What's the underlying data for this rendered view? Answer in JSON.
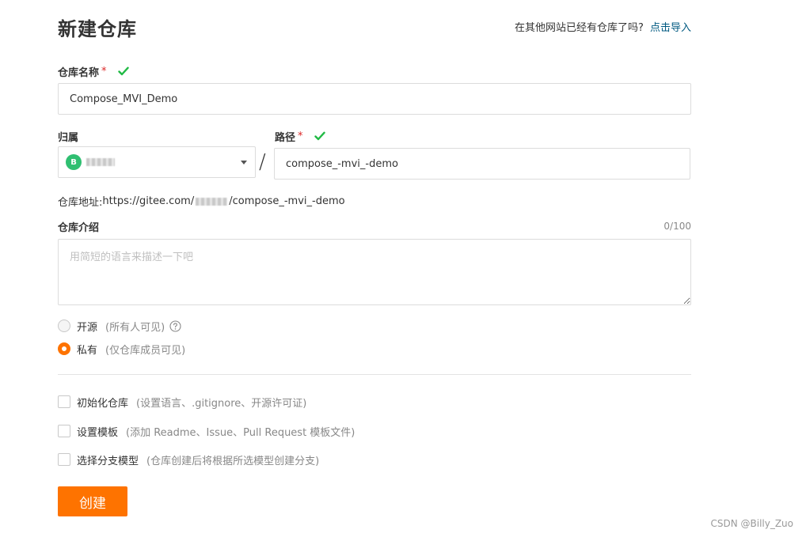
{
  "header": {
    "title": "新建仓库",
    "import_hint": "在其他网站已经有仓库了吗?",
    "import_link": "点击导入"
  },
  "name_field": {
    "label": "仓库名称",
    "required_mark": "*",
    "value": "Compose_MVI_Demo"
  },
  "owner_field": {
    "label": "归属",
    "avatar_letter": "B",
    "avatar_color": "#2fbf71"
  },
  "separator": "/",
  "path_field": {
    "label": "路径",
    "required_mark": "*",
    "value": "compose_-mvi_-demo"
  },
  "address": {
    "label": "仓库地址:",
    "url_prefix": "https://gitee.com/",
    "url_suffix": "/compose_-mvi_-demo"
  },
  "description": {
    "label": "仓库介绍",
    "counter": "0/100",
    "placeholder": "用简短的语言来描述一下吧"
  },
  "visibility": {
    "public_label": "开源",
    "public_note": "(所有人可见)",
    "private_label": "私有",
    "private_note": "(仅仓库成员可见)",
    "selected": "private"
  },
  "options": {
    "init_label": "初始化仓库",
    "init_note": "(设置语言、.gitignore、开源许可证)",
    "template_label": "设置模板",
    "template_note": "(添加 Readme、Issue、Pull Request 模板文件)",
    "branch_label": "选择分支模型",
    "branch_note": "(仓库创建后将根据所选模型创建分支)"
  },
  "create_button": "创建",
  "watermark": "CSDN @Billy_Zuo",
  "colors": {
    "accent": "#fe7300",
    "success": "#21ba45",
    "link": "#005980",
    "required": "#db2828"
  }
}
